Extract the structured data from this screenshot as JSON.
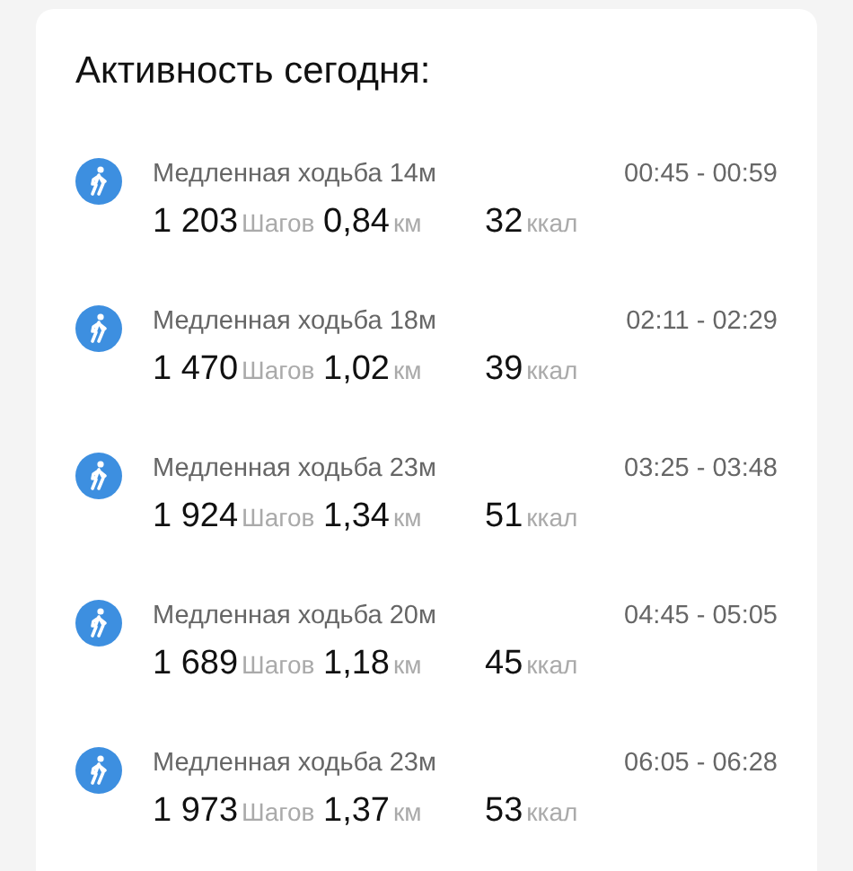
{
  "title": "Активность сегодня:",
  "activities": [
    {
      "name": "Медленная ходьба 14м",
      "time": "00:45 - 00:59",
      "steps": "1 203",
      "steps_unit": "Шагов",
      "distance": "0,84",
      "distance_unit": "км",
      "calories": "32",
      "calories_unit": "ккал"
    },
    {
      "name": "Медленная ходьба 18м",
      "time": "02:11 - 02:29",
      "steps": "1 470",
      "steps_unit": "Шагов",
      "distance": "1,02",
      "distance_unit": "км",
      "calories": "39",
      "calories_unit": "ккал"
    },
    {
      "name": "Медленная ходьба 23м",
      "time": "03:25 - 03:48",
      "steps": "1 924",
      "steps_unit": "Шагов",
      "distance": "1,34",
      "distance_unit": "км",
      "calories": "51",
      "calories_unit": "ккал"
    },
    {
      "name": "Медленная ходьба 20м",
      "time": "04:45 - 05:05",
      "steps": "1 689",
      "steps_unit": "Шагов",
      "distance": "1,18",
      "distance_unit": "км",
      "calories": "45",
      "calories_unit": "ккал"
    },
    {
      "name": "Медленная ходьба 23м",
      "time": "06:05 - 06:28",
      "steps": "1 973",
      "steps_unit": "Шагов",
      "distance": "1,37",
      "distance_unit": "км",
      "calories": "53",
      "calories_unit": "ккал"
    }
  ]
}
